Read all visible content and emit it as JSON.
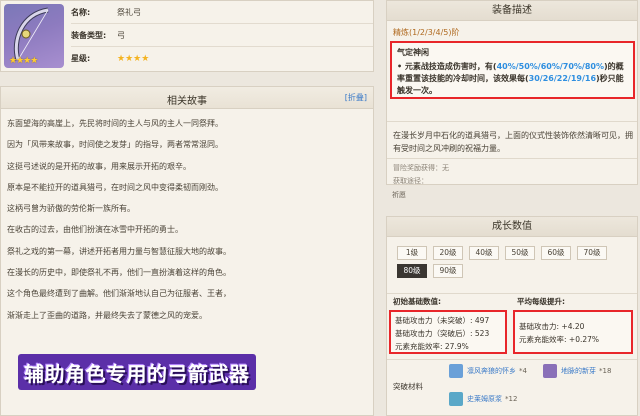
{
  "item": {
    "name_label": "名称:",
    "name_value": "祭礼弓",
    "type_label": "装备类型:",
    "type_value": "弓",
    "rarity_label": "星级:",
    "rarity_stars": "★★★★",
    "thumb_stars": "★★★★"
  },
  "story": {
    "title": "相关故事",
    "fold": "[折叠]",
    "lines": [
      "东面望海的高崖上，先民将时间的主人与风的主人一同祭拜。",
      "因为「风带来故事，时间使之发芽」的指导，两者常常混同。",
      "这挺弓述说的是开拓的故事，用来展示开拓的艰辛。",
      "原本是不能拉开的道具猎弓，在时间之风中变得柔韧而刚劲。",
      "这柄弓曾为骄傲的劳伦斯一族所有。",
      "在收古的过去，由他们扮演在冰雪中开拓的勇士。",
      "祭礼之戏的第一幕，讲述开拓者用力量与智慧征服大地的故事。",
      "在漫长的历史中，即使祭礼不再，他们一直扮演着这样的角色。",
      "这个角色最终遭到了曲解。他们渐渐地认自己为征服者、王者，",
      "渐渐走上了歪曲的道路，并最终失去了蒙德之风的宠爱。"
    ]
  },
  "banner": {
    "text": "辅助角色专用的弓箭武器"
  },
  "description": {
    "title": "装备描述",
    "refine": "精炼(1/2/3/4/5)阶",
    "effect_name": "气定神闲",
    "effect_pre": "• 元素战技造成伤害时，有(",
    "effect_pct": "40%/50%/60%/70%/80%",
    "effect_mid": ")的概率重置该技能的冷却时间，该效果每(",
    "effect_cd": "30/26/22/19/16",
    "effect_post": ")秒只能触发一次。",
    "story": "在漫长岁月中石化的道具猎弓，上面的仪式性装饰依然清晰可见，拥有受时间之风冲刷的祝福力量。",
    "source_label": "冒险奖励获得：无",
    "obtain_label": "获取途径：",
    "obtain_value": "祈愿"
  },
  "growth": {
    "title": "成长数值",
    "levels": [
      "1级",
      "20级",
      "40级",
      "50级",
      "60级",
      "70级",
      "80级",
      "90级"
    ],
    "active_level": "80级",
    "base_head": "初始基础数值:",
    "avg_head": "平均每级提升:",
    "base_lines": [
      "基础攻击力（未突破）: 497",
      "基础攻击力（突破后）: 523",
      "元素充能效率: 27.9%"
    ],
    "avg_lines": [
      "基础攻击力: +4.20",
      "元素充能效率: +0.27%"
    ],
    "materials_label": "突破材料",
    "materials": [
      {
        "name": "凛风奔狼的怀乡",
        "count": "*4",
        "color": "#6aa0d8"
      },
      {
        "name": "地脉的新芽",
        "count": "*18",
        "color": "#8a70b8"
      },
      {
        "name": "史莱姆原浆",
        "count": "*12",
        "color": "#5aa8c8"
      }
    ]
  }
}
